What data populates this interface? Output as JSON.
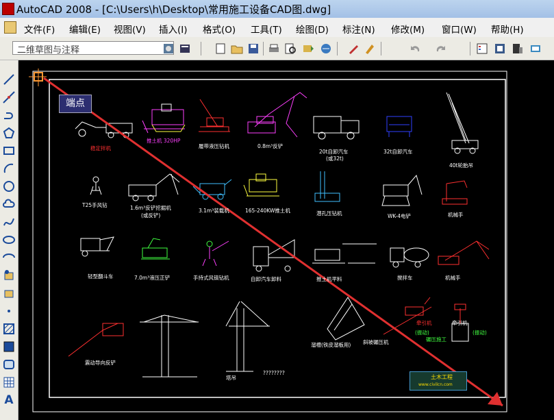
{
  "window": {
    "title": "AutoCAD 2008 - [C:\\Users\\h\\Desktop\\常用施工设备CAD图.dwg]"
  },
  "menu": [
    {
      "label": "文件(F)"
    },
    {
      "label": "编辑(E)"
    },
    {
      "label": "视图(V)"
    },
    {
      "label": "插入(I)"
    },
    {
      "label": "格式(O)"
    },
    {
      "label": "工具(T)"
    },
    {
      "label": "绘图(D)"
    },
    {
      "label": "标注(N)"
    },
    {
      "label": "修改(M)"
    },
    {
      "label": "窗口(W)"
    },
    {
      "label": "帮助(H)"
    }
  ],
  "toolbar": {
    "workspace_value": "二维草图与注释",
    "icons": [
      "workspace-settings-icon",
      "workspace-toolbar-icon",
      "new-icon",
      "open-icon",
      "save-icon",
      "plot-icon",
      "plot-preview-icon",
      "publish-icon",
      "3d-dwf-icon",
      "match-properties-icon",
      "block-editor-icon",
      "undo-icon",
      "redo-icon",
      "properties-icon",
      "design-center-icon",
      "tool-palettes-icon",
      "sheet-set-icon"
    ]
  },
  "left_toolbar": {
    "icons": [
      "line-icon",
      "construction-line-icon",
      "polyline-icon",
      "polygon-icon",
      "rectangle-icon",
      "arc-icon",
      "circle-icon",
      "revision-cloud-icon",
      "spline-icon",
      "ellipse-icon",
      "ellipse-arc-icon",
      "insert-block-icon",
      "make-block-icon",
      "point-icon",
      "hatch-icon",
      "gradient-icon",
      "region-icon",
      "table-icon",
      "multiline-text-icon"
    ],
    "text_tool": "A"
  },
  "tooltip": {
    "label": "端点"
  },
  "drawing": {
    "labels": [
      {
        "text": "稳定拌机",
        "color": "#ff3030"
      },
      {
        "text": "推土机 320HP",
        "color": "#ff40ff"
      },
      {
        "text": "履带液压钻机",
        "color": "#ffffff"
      },
      {
        "text": "0.8m³反铲",
        "color": "#ffffff"
      },
      {
        "text": "20t自卸汽车",
        "color": "#ffffff"
      },
      {
        "text": "(或32t)",
        "color": "#ffffff"
      },
      {
        "text": "32t自卸汽车",
        "color": "#ffffff"
      },
      {
        "text": "40t轮胎吊",
        "color": "#ffffff"
      },
      {
        "text": "T25手风钻",
        "color": "#ffffff"
      },
      {
        "text": "1.6m³反铲挖掘机",
        "color": "#ffffff"
      },
      {
        "text": "(或反铲)",
        "color": "#ffffff"
      },
      {
        "text": "3.1m³装载机",
        "color": "#ffffff"
      },
      {
        "text": "165-240KW推土机",
        "color": "#ffffff"
      },
      {
        "text": "潜孔压钻机",
        "color": "#ffffff"
      },
      {
        "text": "WK-4电铲",
        "color": "#ffffff"
      },
      {
        "text": "机械手",
        "color": "#ffffff"
      },
      {
        "text": "轻型翻斗车",
        "color": "#ffffff"
      },
      {
        "text": "7.0m³液压正铲",
        "color": "#ffffff"
      },
      {
        "text": "手持式风镐钻机",
        "color": "#ffffff"
      },
      {
        "text": "自卸汽车卸料",
        "color": "#ffffff"
      },
      {
        "text": "推土机平料",
        "color": "#ffffff"
      },
      {
        "text": "搅拌车",
        "color": "#ffffff"
      },
      {
        "text": "机械手",
        "color": "#ffffff"
      },
      {
        "text": "塔吊",
        "color": "#ffffff"
      },
      {
        "text": "震动导向反铲",
        "color": "#ffffff"
      },
      {
        "text": "溜槽(铁皮溜板用)",
        "color": "#ffffff"
      },
      {
        "text": "斜坡碾压机",
        "color": "#ffffff"
      },
      {
        "text": "牵引机",
        "color": "#ff3030"
      },
      {
        "text": "(振动)",
        "color": "#40ff40"
      },
      {
        "text": "牵引机",
        "color": "#ffffff"
      },
      {
        "text": "(振动)",
        "color": "#40ff40"
      },
      {
        "text": "碾压施工",
        "color": "#40ff40"
      },
      {
        "text": "????????",
        "color": "#ffffff"
      }
    ],
    "logo": {
      "title": "土木工程",
      "url": "www.civilcn.com"
    }
  },
  "colors": {
    "canvas": "#000000",
    "arrow": "#e03030",
    "frame": "#ffffff"
  }
}
